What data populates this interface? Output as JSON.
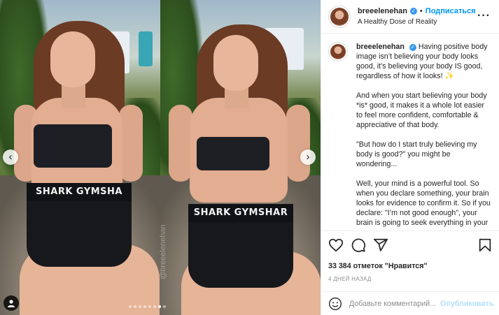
{
  "post": {
    "username": "breeelenehan",
    "follow_label": "Подписаться",
    "location": "A Healthy Dose of Reality",
    "more_glyph": "···",
    "photo_left_brand": "SHARK GYMSHA",
    "photo_right_brand": "SHARK GYMSHAR",
    "watermark": "@breeelenehan",
    "nav_prev": "‹",
    "nav_next": "›",
    "carousel_dots": 8,
    "carousel_active": 6
  },
  "caption": {
    "p1": "Having positive body image isn’t believing your body looks good, it’s believing your body IS good, regardless of how it looks! ✨",
    "p2": "And when you start believing your body *is* good, it makes it a whole lot easier to feel more confident, comfortable & appreciative of that body.",
    "p3": "\"But how do I start truly believing my body is good?\" you might be wondering...",
    "p4": "Well, your mind is a powerful tool. So when you declare something, your brain looks for evidence to confirm it. So if you declare: \"I’m not good enough\", your brain is going to seek everything in your"
  },
  "actions": {
    "likes": "33 384 отметок \"Нравится\"",
    "date": "4 ДНЕЙ НАЗАД"
  },
  "comment": {
    "placeholder": "Добавьте комментарий...",
    "publish_label": "Опубликовать"
  },
  "colors": {
    "accent": "#0095f6",
    "verified": "#3897f0",
    "publish_disabled": "#b2dffc",
    "muted": "#8e8e8e"
  },
  "icons": [
    "heart-icon",
    "comment-icon",
    "share-icon",
    "bookmark-icon",
    "smile-icon",
    "verified-icon",
    "more-icon",
    "user-tag-icon"
  ]
}
